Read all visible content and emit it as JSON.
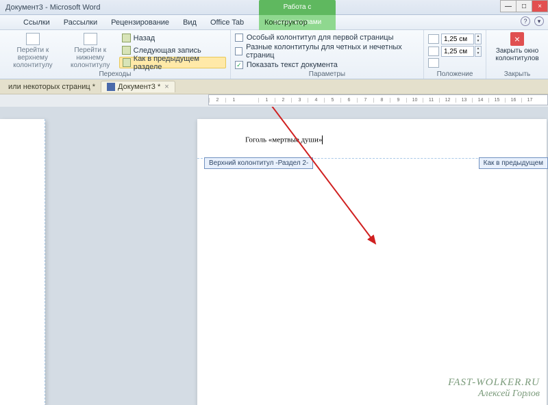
{
  "title": "Документ3 - Microsoft Word",
  "contextual": {
    "groupTitle": "Работа с колонтитулами",
    "tab": "Конструктор"
  },
  "menu": {
    "links": "Ссылки",
    "mail": "Рассылки",
    "review": "Рецензирование",
    "view": "Вид",
    "office": "Office Tab"
  },
  "ribbon": {
    "goTop": "Перейти к верхнему\nколонтитулу",
    "goBottom": "Перейти к нижнему\nколонтитулу",
    "back": "Назад",
    "next": "Следующая запись",
    "linkPrev": "Как в предыдущем разделе",
    "transitions": "Переходы",
    "opt1": "Особый колонтитул для первой страницы",
    "opt2": "Разные колонтитулы для четных и нечетных страниц",
    "opt3": "Показать текст документа",
    "params": "Параметры",
    "posTop": "1,25 см",
    "posBot": "1,25 см",
    "position": "Положение",
    "closeLabel": "Закрыть окно\nколонтитулов",
    "closeGroup": "Закрыть"
  },
  "tabs": {
    "prev": "или некоторых страниц *",
    "doc": "Документ3 *"
  },
  "doc": {
    "headerText": "Гоголь «мертвые души»",
    "tagLeft": "Верхний колонтитул -Раздел 2-",
    "tagRight": "Как в предыдущем"
  },
  "watermark": {
    "site": "FAST-WOLKER.RU",
    "author": "Алексей Горлов"
  }
}
